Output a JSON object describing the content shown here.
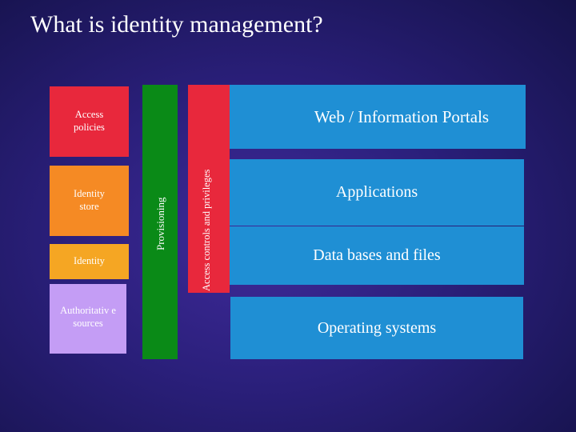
{
  "slide": {
    "title": "What is identity management?"
  },
  "left_stack": {
    "access_policies": "Access policies",
    "identity_store": "Identity store",
    "identity": "Identity",
    "authoritative_sources": "Authoritativ e sources"
  },
  "vertical_bars": {
    "provisioning": "Provisioning",
    "access_controls": "Access controls and privileges"
  },
  "layers": {
    "portals": "Web / Information Portals",
    "applications": "Applications",
    "databases": "Data bases and files",
    "operating_systems": "Operating systems"
  },
  "colors": {
    "red": "#e8283c",
    "orange": "#f58a24",
    "yellow_orange": "#f5a623",
    "lavender": "#c49df5",
    "green": "#0a8a17",
    "blue": "#1f8fd4",
    "background": "#2a1f7a"
  }
}
